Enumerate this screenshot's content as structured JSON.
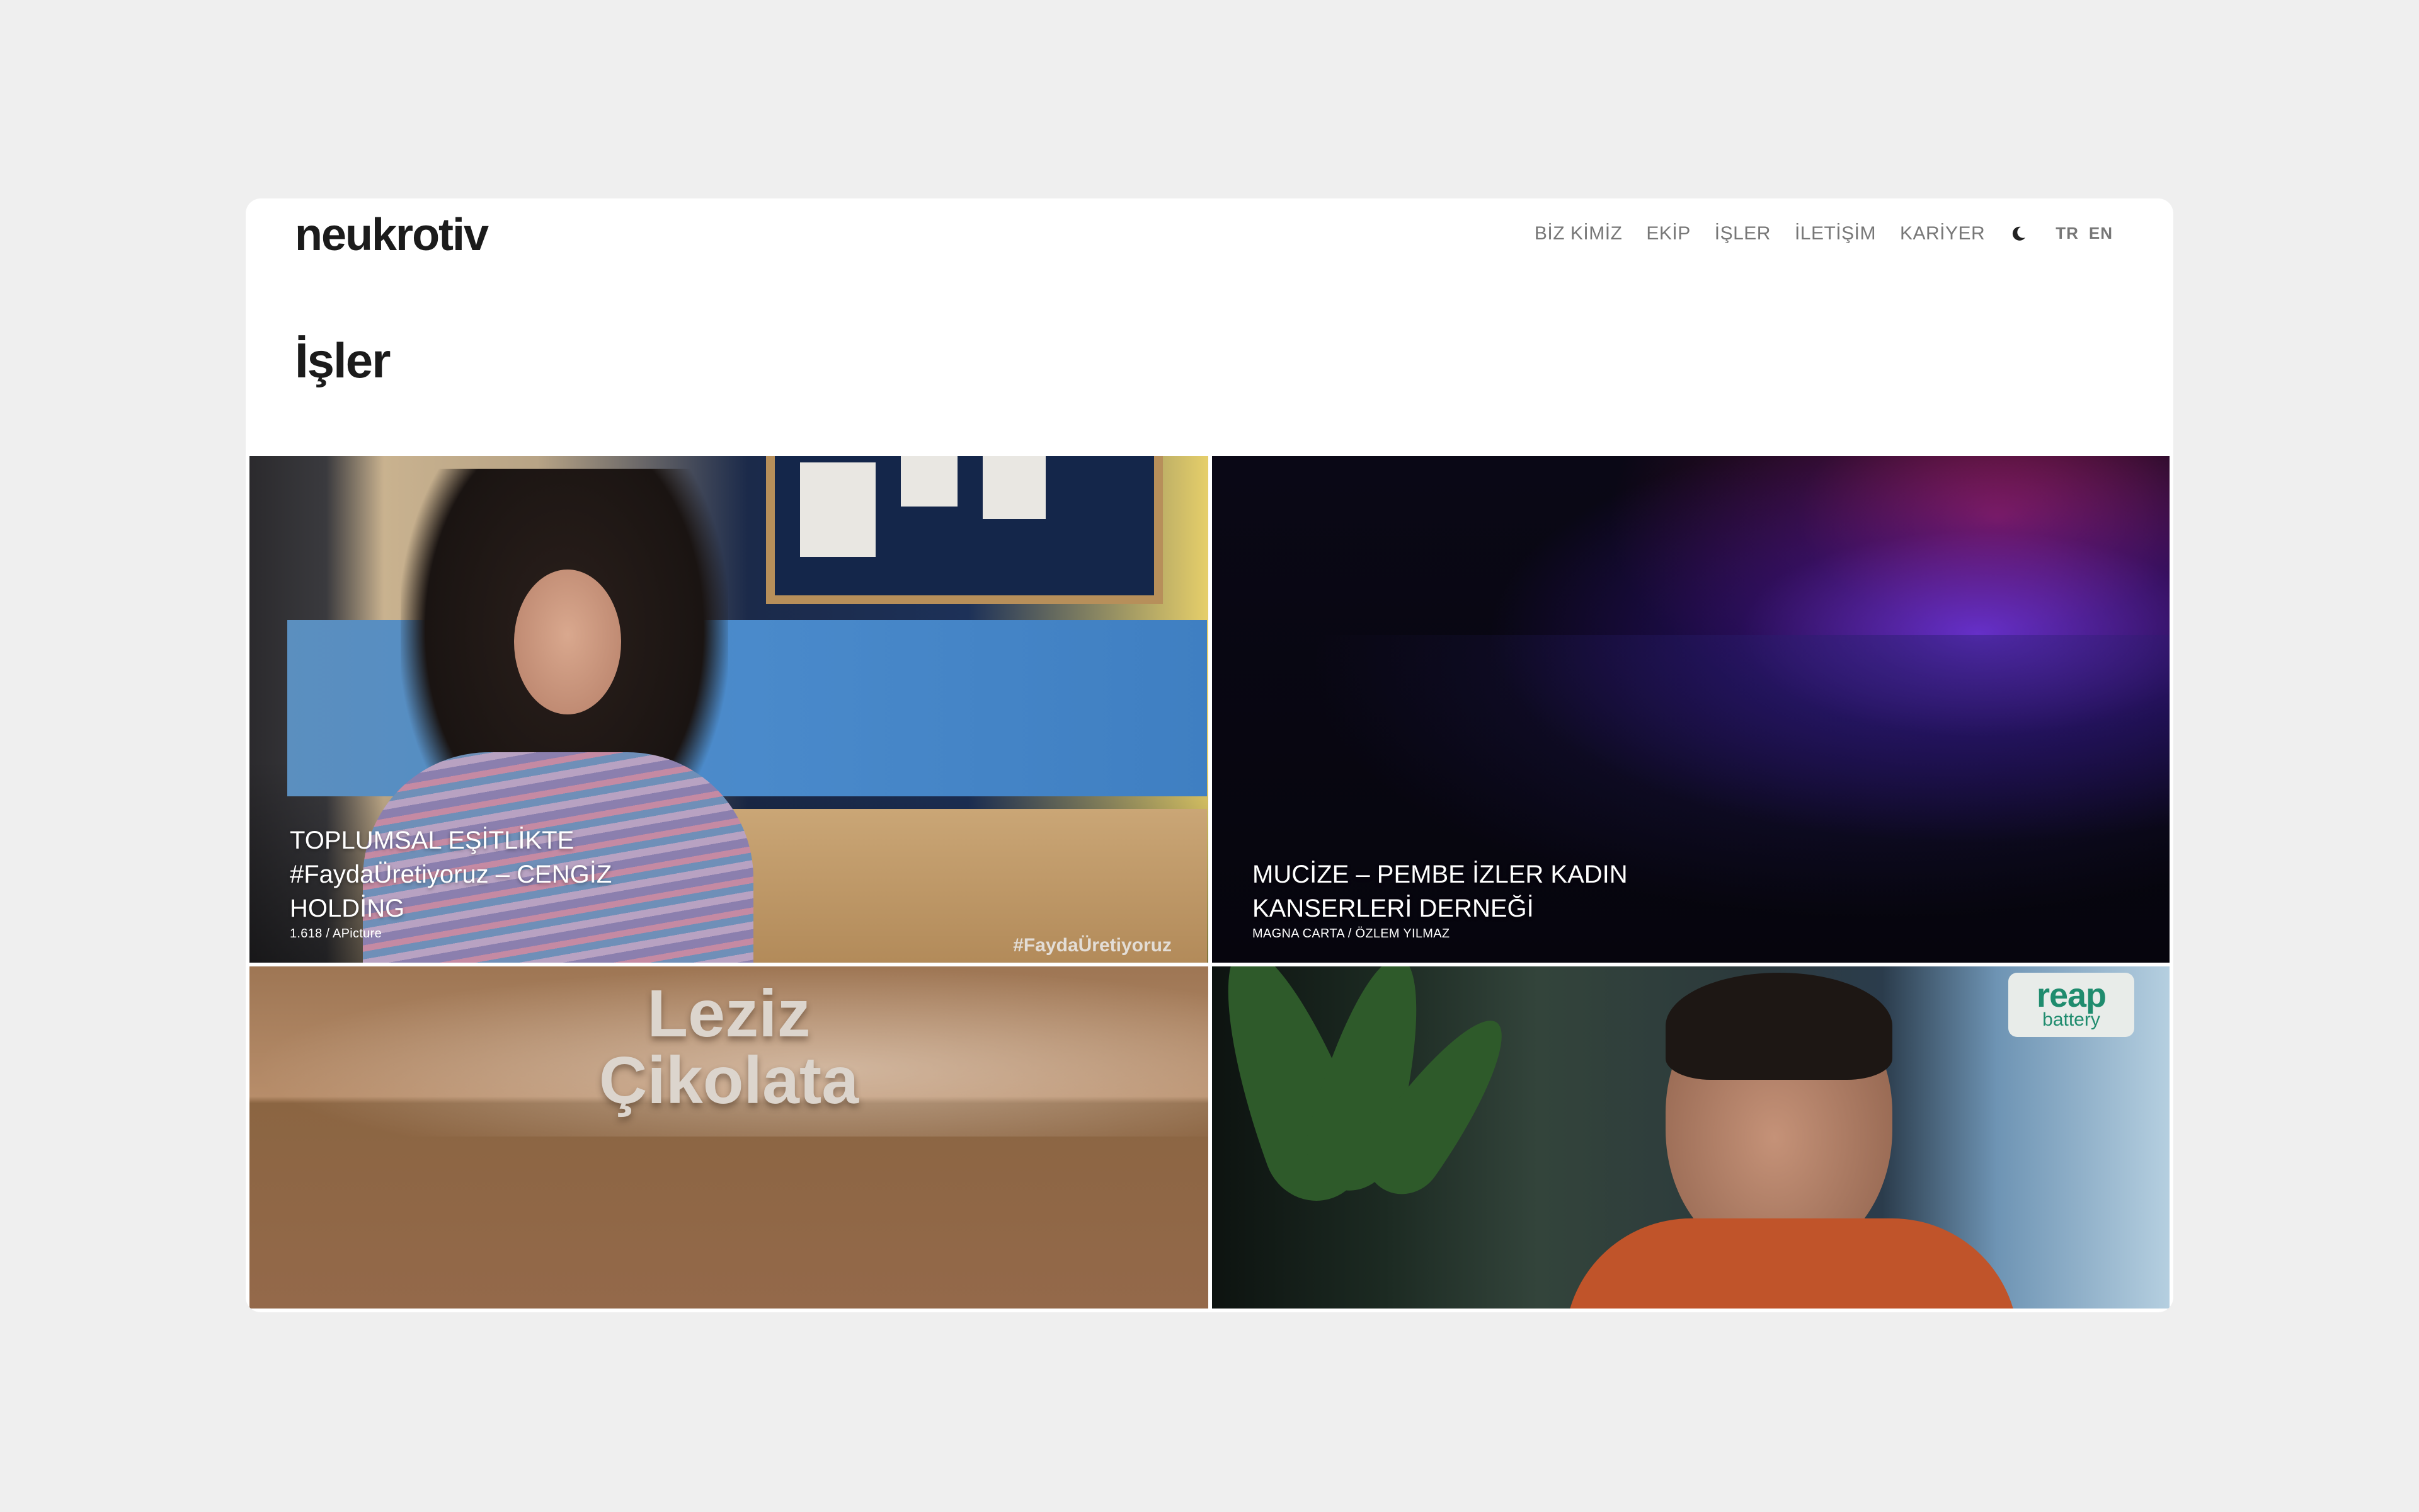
{
  "header": {
    "logo": "neukrotiv",
    "nav": [
      "BİZ KİMİZ",
      "EKİP",
      "İŞLER",
      "İLETİŞİM",
      "KARİYER"
    ],
    "theme_toggle_icon": "moon-icon",
    "languages": [
      "TR",
      "EN"
    ]
  },
  "page": {
    "title": "İşler"
  },
  "works": [
    {
      "title": "TOPLUMSAL EŞİTLİKTE #FaydaÜretiyoruz – CENGİZ HOLDİNG",
      "subtitle": "1.618 / APicture",
      "watermark": "#FaydaÜretiyoruz"
    },
    {
      "title": "MUCİZE – PEMBE İZLER KADIN KANSERLERİ DERNEĞİ",
      "subtitle": "MAGNA CARTA / ÖZLEM YILMAZ"
    },
    {
      "headline_line1": "Leziz",
      "headline_line2": "Çikolata"
    },
    {
      "badge_line1": "reap",
      "badge_line2": "battery"
    }
  ]
}
